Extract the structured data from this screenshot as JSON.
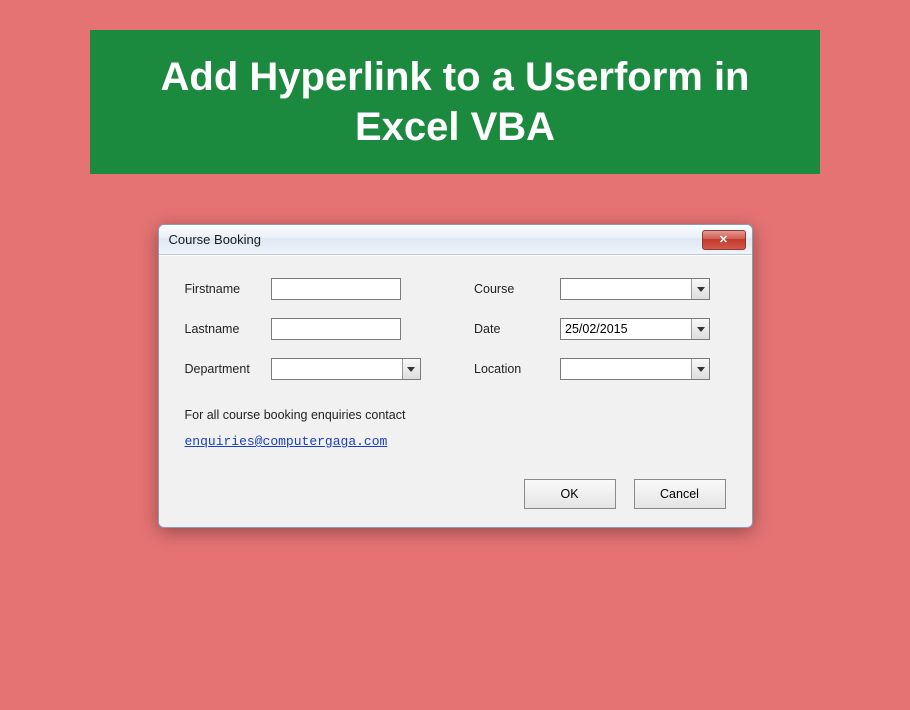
{
  "banner": {
    "title": "Add Hyperlink to a Userform in Excel VBA"
  },
  "window": {
    "title": "Course Booking",
    "close_label": "✕"
  },
  "form": {
    "firstname": {
      "label": "Firstname",
      "value": ""
    },
    "lastname": {
      "label": "Lastname",
      "value": ""
    },
    "department": {
      "label": "Department",
      "value": ""
    },
    "course": {
      "label": "Course",
      "value": ""
    },
    "date": {
      "label": "Date",
      "value": "25/02/2015"
    },
    "location": {
      "label": "Location",
      "value": ""
    }
  },
  "contact": {
    "text": "For all course booking enquiries contact",
    "email": "enquiries@computergaga.com"
  },
  "buttons": {
    "ok": "OK",
    "cancel": "Cancel"
  }
}
